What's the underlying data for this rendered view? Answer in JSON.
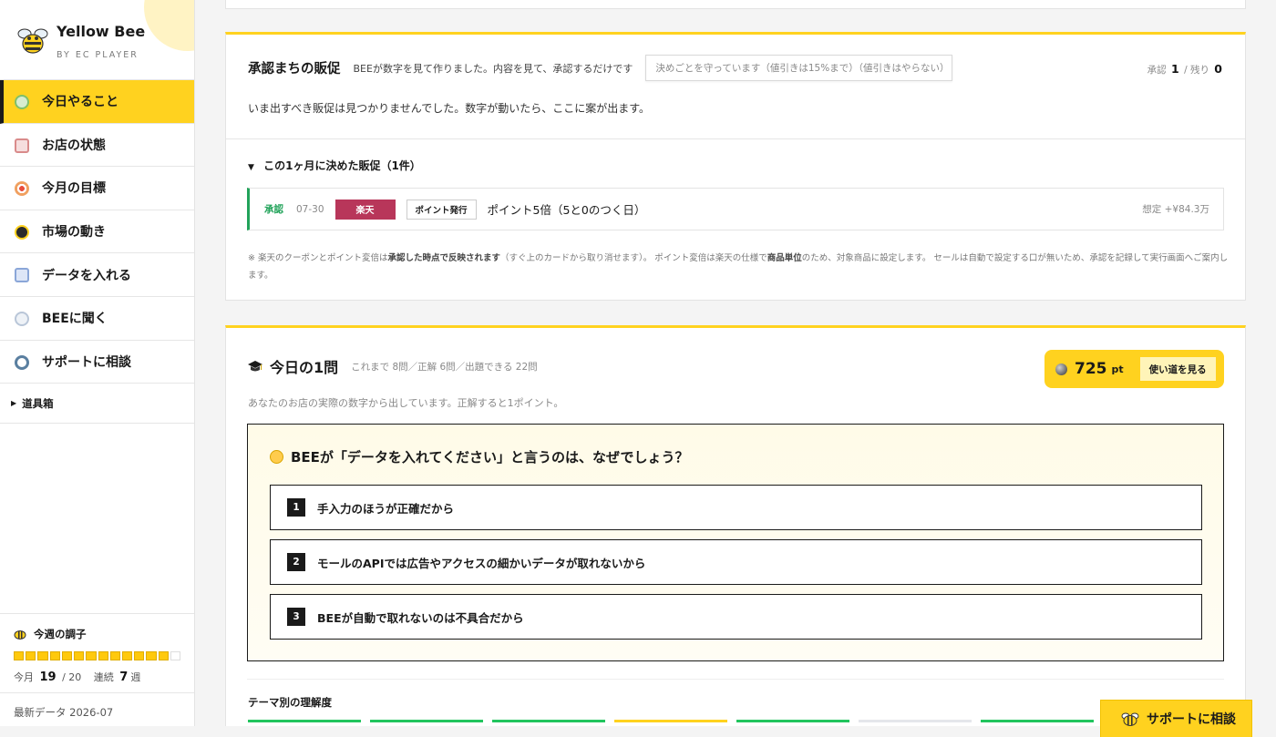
{
  "brand": {
    "name": "Yellow Bee",
    "sub": "BY EC PLAYER"
  },
  "nav": [
    {
      "label": "今日やること",
      "icon": "clipboard-icon",
      "active": true,
      "color": "#d8ecd0"
    },
    {
      "label": "お店の状態",
      "icon": "cake-icon",
      "active": false,
      "color": "#f1c9c9"
    },
    {
      "label": "今月の目標",
      "icon": "target-icon",
      "active": false,
      "color": "#f0b58a"
    },
    {
      "label": "市場の動き",
      "icon": "chart-icon",
      "active": false,
      "color": "#2b2b2b"
    },
    {
      "label": "データを入れる",
      "icon": "inbox-icon",
      "active": false,
      "color": "#c9d6f0"
    },
    {
      "label": "BEEに聞く",
      "icon": "chat-icon",
      "active": false,
      "color": "#d9e2ef"
    },
    {
      "label": "サポートに相談",
      "icon": "support-icon",
      "active": false,
      "color": "#cfe0ec"
    }
  ],
  "toolbox": {
    "label": "道具箱"
  },
  "weekly": {
    "title": "今週の調子",
    "filled": 13,
    "total": 14,
    "month_label": "今月",
    "month_value": "19",
    "month_total": "/ 20",
    "streak_label": "連続",
    "streak_value": "7",
    "streak_unit": "週"
  },
  "latest": "最新データ 2026-07",
  "promo_card": {
    "title": "承認まちの販促",
    "subtitle": "BEEが数字を見て作りました。内容を見て、承認するだけです",
    "policy": "決めごとを守っています（値引きは15%まで）（値引きはやらない）",
    "approved_label": "承認",
    "approved_count": "1",
    "remaining_label": "/ 残り",
    "remaining_count": "0",
    "empty_message": "いま出すべき販促は見つかりませんでした。数字が動いたら、ここに案が出ます。",
    "decided_label": "この1ヶ月に決めた販促（1件）",
    "items": [
      {
        "status": "承認",
        "date": "07-30",
        "mall": "楽天",
        "type": "ポイント発行",
        "name": "ポイント5倍（5と0のつく日）",
        "estimate": "想定 +¥84.3万"
      }
    ],
    "note_a": "※ 楽天のクーポンとポイント変倍は",
    "note_b": "承認した時点で反映されます",
    "note_c": "（すぐ上のカードから取り消せます）。 ポイント変倍は楽天の仕様で",
    "note_d": "商品単位",
    "note_e": "のため、対象商品に設定します。 セールは自動で設定する口が無いため、承認を記録して実行画面へご案内します。"
  },
  "quiz": {
    "title": "今日の1問",
    "stats": "これまで 8問／正解 6問／出題できる 22問",
    "points": "725",
    "points_unit": "pt",
    "points_button": "使い道を見る",
    "description": "あなたのお店の実際の数字から出しています。正解すると1ポイント。",
    "question": "BEEが「データを入れてください」と言うのは、なぜでしょう？",
    "options": [
      {
        "num": "1",
        "text": "手入力のほうが正確だから"
      },
      {
        "num": "2",
        "text": "モールのAPIでは広告やアクセスの細かいデータが取れないから"
      },
      {
        "num": "3",
        "text": "BEEが自動で取れないのは不具合だから"
      }
    ],
    "theme_title": "テーマ別の理解度",
    "theme_colors": [
      "#22c55e",
      "#22c55e",
      "#22c55e",
      "#ffd21f",
      "#22c55e",
      "#e5e7eb",
      "#22c55e"
    ]
  },
  "support_button": "サポートに相談",
  "colors": {
    "accent": "#ffd21f",
    "success": "#22a35a",
    "rakuten": "#b8365a"
  }
}
